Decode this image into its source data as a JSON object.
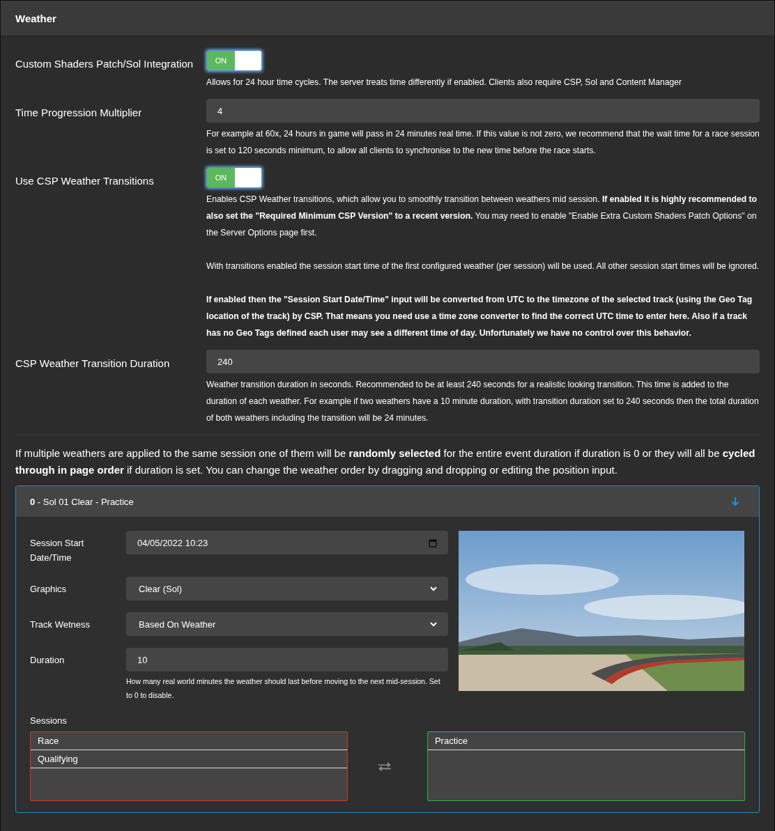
{
  "panel": {
    "title": "Weather"
  },
  "settings": [
    {
      "kind": "toggle",
      "label": "Custom Shaders Patch/Sol Integration",
      "on": true,
      "toggle_text": "ON",
      "help": [
        "Allows for 24 hour time cycles. The server treats time differently if enabled. Clients also require CSP, Sol and Content Manager"
      ]
    },
    {
      "kind": "input",
      "label": "Time Progression Multiplier",
      "value": "4",
      "help": [
        "For example at 60x, 24 hours in game will pass in 24 minutes real time. If this value is not zero, we recommend that the wait time for a race session is set to 120 seconds minimum, to allow all clients to synchronise to the new time before the race starts."
      ]
    },
    {
      "kind": "toggle",
      "label": "Use CSP Weather Transitions",
      "on": true,
      "toggle_text": "ON",
      "help": [
        "Enables CSP Weather transitions, which allow you to smoothly transition between weathers mid session. **If enabled it is highly recommended to also set the \"Required Minimum CSP Version\" to a recent version.** You may need to enable \"Enable Extra Custom Shaders Patch Options\" on the Server Options page first.",
        "With transitions enabled the session start time of the first configured weather (per session) will be used. All other session start times will be ignored.",
        "**If enabled then the \"Session Start Date/Time\" input will be converted from UTC to the timezone of the selected track (using the Geo Tag location of the track) by CSP. That means you need use a time zone converter to find the correct UTC time to enter here. Also if a track has no Geo Tags defined each user may see a different time of day. Unfortunately we have no control over this behavior.**"
      ]
    },
    {
      "kind": "input",
      "label": "CSP Weather Transition Duration",
      "value": "240",
      "help": [
        "Weather transition duration in seconds. Recommended to be at least 240 seconds for a realistic looking transition. This time is added to the duration of each weather. For example if two weathers have a 10 minute duration, with transition duration set to 240 seconds then the total duration of both weathers including the transition will be 24 minutes."
      ]
    }
  ],
  "note": "If multiple weathers are applied to the same session one of them will be **randomly selected** for the entire event duration if duration is 0 or they will all be **cycled through in page order** if duration is set. You can change the weather order by dragging and dropping or editing the position input.",
  "weathers": [
    {
      "title": "**0** - Sol 01 Clear - Practice",
      "expanded": true,
      "fields": [
        {
          "kind": "datetime",
          "label": "Session Start Date/Time",
          "value": "04/05/2022  10:23"
        },
        {
          "kind": "select",
          "label": "Graphics",
          "value": "Clear (Sol)"
        },
        {
          "kind": "select",
          "label": "Track Wetness",
          "value": "Based On Weather"
        },
        {
          "kind": "input",
          "label": "Duration",
          "value": "10",
          "help": "How many real world minutes the weather should last before moving to the next mid-session. Set to 0 to disable."
        }
      ],
      "sessions": {
        "label": "Sessions",
        "unused": [
          "Race",
          "Qualifying"
        ],
        "used": [
          "Practice"
        ]
      }
    }
  ]
}
